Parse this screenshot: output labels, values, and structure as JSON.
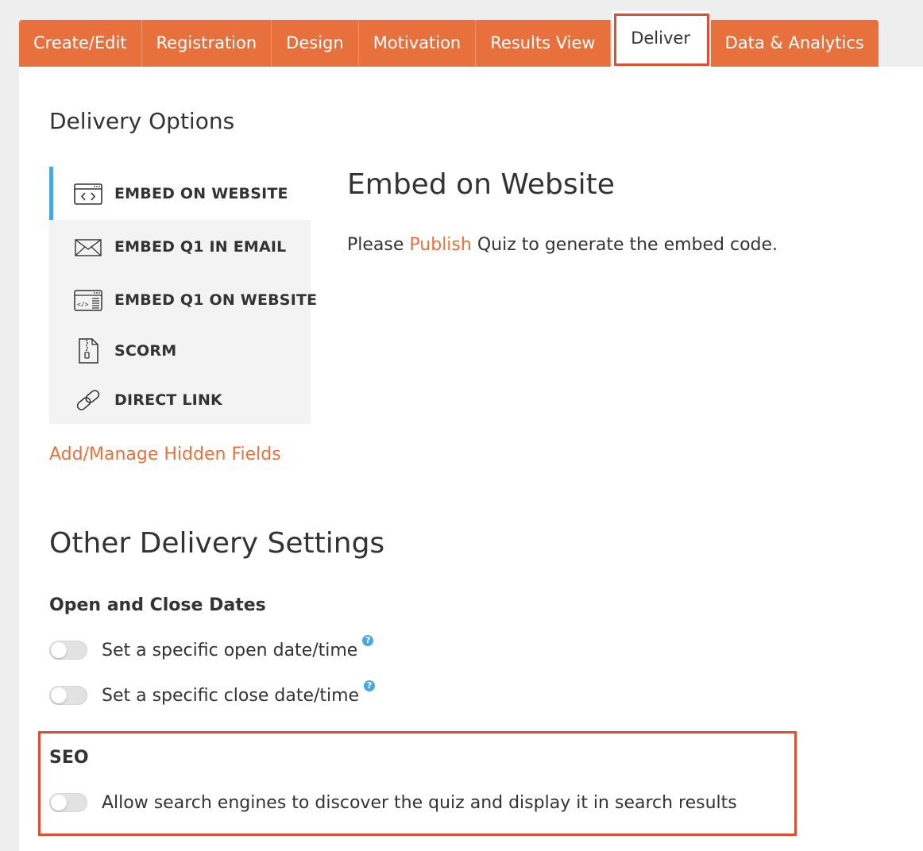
{
  "tabs": [
    {
      "label": "Create/Edit"
    },
    {
      "label": "Registration"
    },
    {
      "label": "Design"
    },
    {
      "label": "Motivation"
    },
    {
      "label": "Results View"
    },
    {
      "label": "Deliver",
      "active": true
    },
    {
      "label": "Data & Analytics"
    }
  ],
  "delivery_options": {
    "heading": "Delivery Options",
    "items": [
      {
        "label": "EMBED ON WEBSITE",
        "icon": "browser-code-icon",
        "active": true
      },
      {
        "label": "EMBED Q1 IN EMAIL",
        "icon": "envelope-icon"
      },
      {
        "label": "EMBED Q1 ON WEBSITE",
        "icon": "browser-embed-icon"
      },
      {
        "label": "SCORM",
        "icon": "zip-file-icon"
      },
      {
        "label": "DIRECT LINK",
        "icon": "link-icon"
      }
    ],
    "hidden_fields_link": "Add/Manage Hidden Fields"
  },
  "embed": {
    "heading": "Embed on Website",
    "msg_prefix": "Please",
    "msg_link": "Publish",
    "msg_suffix": "Quiz to generate the embed code."
  },
  "other_settings": {
    "heading": "Other Delivery Settings",
    "dates_heading": "Open and Close Dates",
    "open_date_label": "Set a specific open date/time",
    "close_date_label": "Set a specific close date/time",
    "seo_heading": "SEO",
    "seo_label": "Allow search engines to discover the quiz and display it in search results",
    "help_glyph": "?",
    "open_date_enabled": false,
    "close_date_enabled": false,
    "seo_enabled": false
  },
  "colors": {
    "accent": "#e8703c",
    "highlight": "#e34b32",
    "active_indicator": "#4aa8e0"
  }
}
